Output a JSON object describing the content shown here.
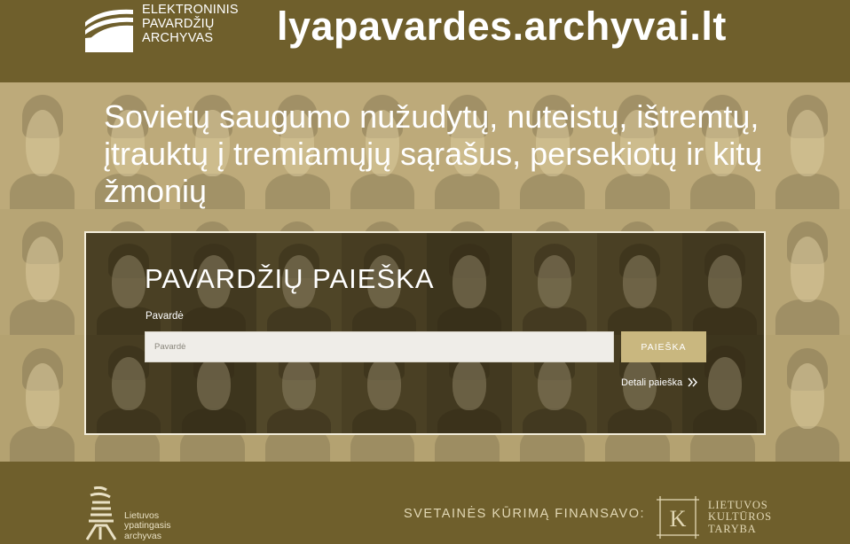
{
  "header": {
    "logo_lines": [
      "ELEKTRONINIS",
      "PAVARDŽIŲ",
      "ARCHYVAS"
    ],
    "site_title": "lyapavardes.archyvai.lt"
  },
  "hero": {
    "title": "Sovietų saugumo nužudytų, nuteistų, ištremtų, įtrauktų į tremiamųjų sąrašus, persekiotų ir kitų žmonių"
  },
  "search": {
    "title": "PAVARDŽIŲ PAIEŠKA",
    "field_label": "Pavardė",
    "placeholder": "Pavardė",
    "value": "",
    "button_label": "PAIEŠKA",
    "detail_link": "Detali paieška"
  },
  "footer": {
    "lya_lines": [
      "Lietuvos",
      "ypatingasis",
      "archyvas"
    ],
    "funded_by": "SVETAINĖS KŪRIMĄ FINANSAVO:",
    "ltk_letter": "K",
    "ltk_lines": [
      "LIETUVOS",
      "KULTŪROS",
      "TARYBA"
    ]
  },
  "colors": {
    "brand_olive": "#6f5f2c",
    "button_gold": "#c9b77f",
    "hero_tint": "#cdbc87"
  }
}
